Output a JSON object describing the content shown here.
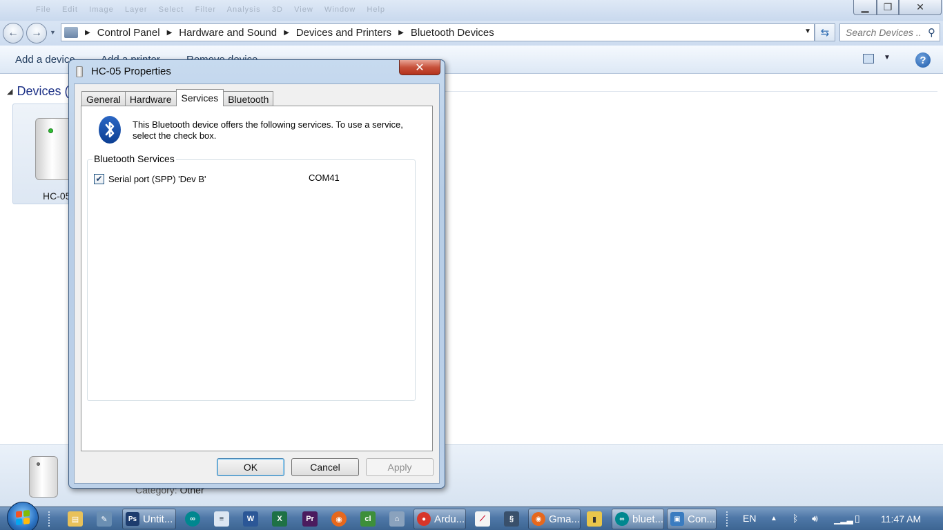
{
  "explorer": {
    "ghost_menu": [
      "File",
      "Edit",
      "Image",
      "Layer",
      "Select",
      "Filter",
      "Analysis",
      "3D",
      "View",
      "Window",
      "Help"
    ],
    "breadcrumb": [
      "Control Panel",
      "Hardware and Sound",
      "Devices and Printers",
      "Bluetooth Devices"
    ],
    "search_placeholder": "Search Devices ...",
    "commands": {
      "add_device": "Add a device",
      "add_printer": "Add a printer",
      "remove_device": "Remove device"
    },
    "group_header": "Devices (",
    "device_name": "HC-05",
    "details": {
      "category_label": "Category:",
      "category_value": "Other"
    }
  },
  "dialog": {
    "title": "HC-05 Properties",
    "close_glyph": "✕",
    "tabs": [
      {
        "label": "General"
      },
      {
        "label": "Hardware"
      },
      {
        "label": "Services"
      },
      {
        "label": "Bluetooth"
      }
    ],
    "active_tab": "Services",
    "intro_text": "This Bluetooth device offers the following services. To use a service, select the check box.",
    "group_title": "Bluetooth Services",
    "services": [
      {
        "name": "Serial port (SPP) 'Dev B'",
        "port": "COM41",
        "checked": true
      }
    ],
    "buttons": {
      "ok": "OK",
      "cancel": "Cancel",
      "apply": "Apply"
    }
  },
  "taskbar": {
    "tasks": [
      {
        "label": "Untit...",
        "icon": "photoshop-icon",
        "color": "#1d3c6e",
        "glyph": "Ps"
      },
      {
        "label": "Ardu...",
        "icon": "chrome-icon",
        "color": "#d8362a",
        "glyph": "●"
      },
      {
        "label": "Gma...",
        "icon": "firefox-icon",
        "color": "#e6681d",
        "glyph": "◉"
      },
      {
        "label": "bluet...",
        "icon": "arduino-icon",
        "color": "#00878f",
        "glyph": "∞"
      },
      {
        "label": "Con...",
        "icon": "control-panel-icon",
        "color": "#3a7cc0",
        "glyph": "▣"
      }
    ],
    "language": "EN",
    "clock": "11:47 AM"
  },
  "colors": {
    "bluetooth_blue": "#0c3f93",
    "close_red": "#c7513b",
    "link_blue": "#1e395b"
  }
}
